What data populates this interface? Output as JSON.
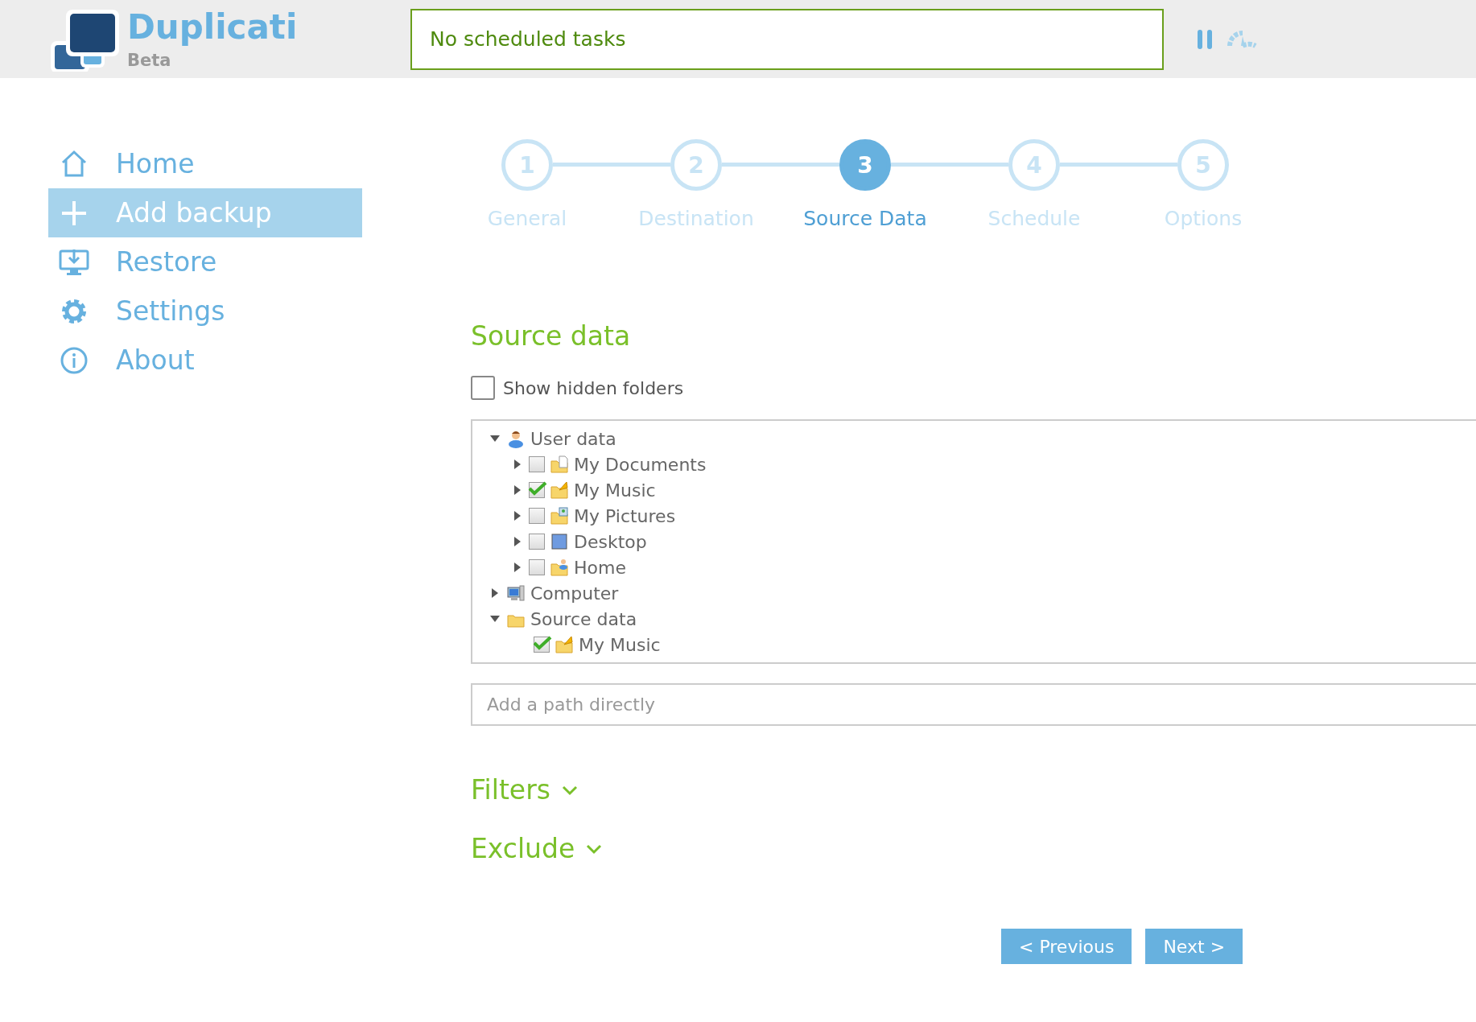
{
  "header": {
    "logo_title": "Duplicati",
    "logo_subtitle": "Beta",
    "status": "No scheduled tasks"
  },
  "sidebar": {
    "items": [
      {
        "label": "Home",
        "kind": "home",
        "selected": false
      },
      {
        "label": "Add backup",
        "kind": "add",
        "selected": true
      },
      {
        "label": "Restore",
        "kind": "restore",
        "selected": false
      },
      {
        "label": "Settings",
        "kind": "settings",
        "selected": false
      },
      {
        "label": "About",
        "kind": "about",
        "selected": false
      }
    ]
  },
  "steps": [
    {
      "number": "1",
      "label": "General",
      "selected": false
    },
    {
      "number": "2",
      "label": "Destination",
      "selected": false
    },
    {
      "number": "3",
      "label": "Source Data",
      "selected": true
    },
    {
      "number": "4",
      "label": "Schedule",
      "selected": false
    },
    {
      "number": "5",
      "label": "Options",
      "selected": false
    }
  ],
  "section_title": "Source data",
  "show_hidden": {
    "label": "Show hidden folders",
    "checked": false
  },
  "tree": [
    {
      "label": "User data",
      "kind": "user",
      "expanded": true,
      "children": [
        {
          "label": "My Documents",
          "kind": "documents",
          "expanded": false,
          "checked": false
        },
        {
          "label": "My Music",
          "kind": "music",
          "expanded": false,
          "checked": true
        },
        {
          "label": "My Pictures",
          "kind": "pictures",
          "expanded": false,
          "checked": false
        },
        {
          "label": "Desktop",
          "kind": "desktop",
          "expanded": false,
          "checked": false
        },
        {
          "label": "Home",
          "kind": "home",
          "expanded": false,
          "checked": false
        }
      ]
    },
    {
      "label": "Computer",
      "kind": "computer",
      "expanded": false
    },
    {
      "label": "Source data",
      "kind": "folder",
      "expanded": true,
      "children": [
        {
          "label": "My Music",
          "kind": "music",
          "checked": true
        }
      ]
    }
  ],
  "path_field": {
    "placeholder": "Add a path directly"
  },
  "sections": [
    {
      "label": "Filters",
      "expanded": false
    },
    {
      "label": "Exclude",
      "expanded": false
    }
  ],
  "buttons": [
    "< Previous",
    "Next >"
  ]
}
